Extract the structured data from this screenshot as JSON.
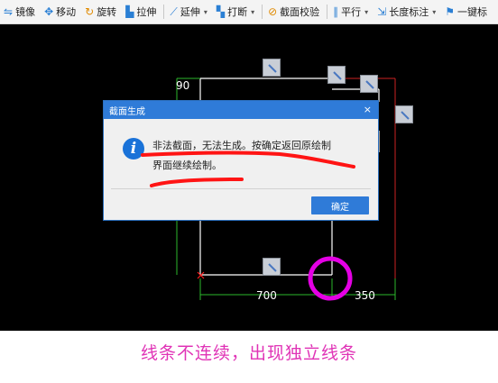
{
  "toolbar": {
    "items": [
      {
        "icon": "mirror-icon",
        "label": "镜像",
        "dropdown": false
      },
      {
        "icon": "move-icon",
        "label": "移动",
        "dropdown": false
      },
      {
        "icon": "rotate-icon",
        "label": "旋转",
        "dropdown": false
      },
      {
        "icon": "stretch-icon",
        "label": "拉伸",
        "dropdown": false
      },
      {
        "icon": "extend-icon",
        "label": "延伸",
        "dropdown": true
      },
      {
        "icon": "break-icon",
        "label": "打断",
        "dropdown": true
      },
      {
        "icon": "check-shield-icon",
        "label": "截面校验",
        "dropdown": false
      },
      {
        "icon": "parallel-icon",
        "label": "平行",
        "dropdown": true
      },
      {
        "icon": "length-dimension-icon",
        "label": "长度标注",
        "dropdown": true
      },
      {
        "icon": "one-key-icon",
        "label": "一键标",
        "dropdown": false
      }
    ]
  },
  "canvas": {
    "dimensions": {
      "top_label": "90",
      "bottom_left_label": "700",
      "bottom_right_label": "350"
    },
    "colors": {
      "background": "#000000",
      "lines": "#ffffff",
      "dimension_lines": "#2db92d",
      "highlight_circle": "#e400e4",
      "marker": "#ff1a1a"
    }
  },
  "dialog": {
    "title": "截面生成",
    "close_glyph": "×",
    "message_line1": "非法截面，无法生成。按确定返回原绘制",
    "message_line2": "界面继续绘制。",
    "ok_label": "确定",
    "icon": "info-icon"
  },
  "caption": "线条不连续，出现独立线条"
}
